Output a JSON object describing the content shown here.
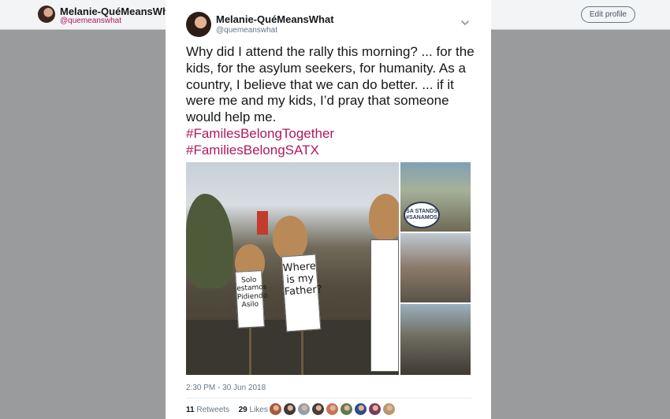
{
  "background_profile": {
    "name": "Melanie-QuéMeansWhat",
    "handle": "@quemeanswhat",
    "edit_profile_label": "Edit profile"
  },
  "tweet": {
    "author_name": "Melanie-QuéMeansWhat",
    "author_handle": "@quemeanswhat",
    "text": "Why did I attend the rally this morning? ... for the kids, for the asylum seekers, for humanity. As a country, I believe that we can do better. ... if it were me and my kids, I’d pray that someone would help me.",
    "hashtags": [
      "#FamilesBelongTogether",
      "#FamiliesBelongSATX"
    ],
    "photo_sign_1": "Where is my Father?",
    "photo_sign_2": "Solo estamos Pidiendo Asilo",
    "photo_badge": "SA STANDS #SANAMOS",
    "timestamp": "2:30 PM - 30 Jun 2018",
    "retweets_count": "11",
    "retweets_label": "Retweets",
    "likes_count": "29",
    "likes_label": "Likes",
    "menu_icon": "chevron-down-icon"
  },
  "colors": {
    "hashtag": "#b0185e",
    "overlay": "#9a9b9d",
    "liker_avatars": [
      "#a55a3c",
      "#3f3a36",
      "#8fa0b0",
      "#4a3b35",
      "#c9745a",
      "#5e7a4f",
      "#2f4f8c",
      "#7a3b5c",
      "#b59a70"
    ]
  }
}
